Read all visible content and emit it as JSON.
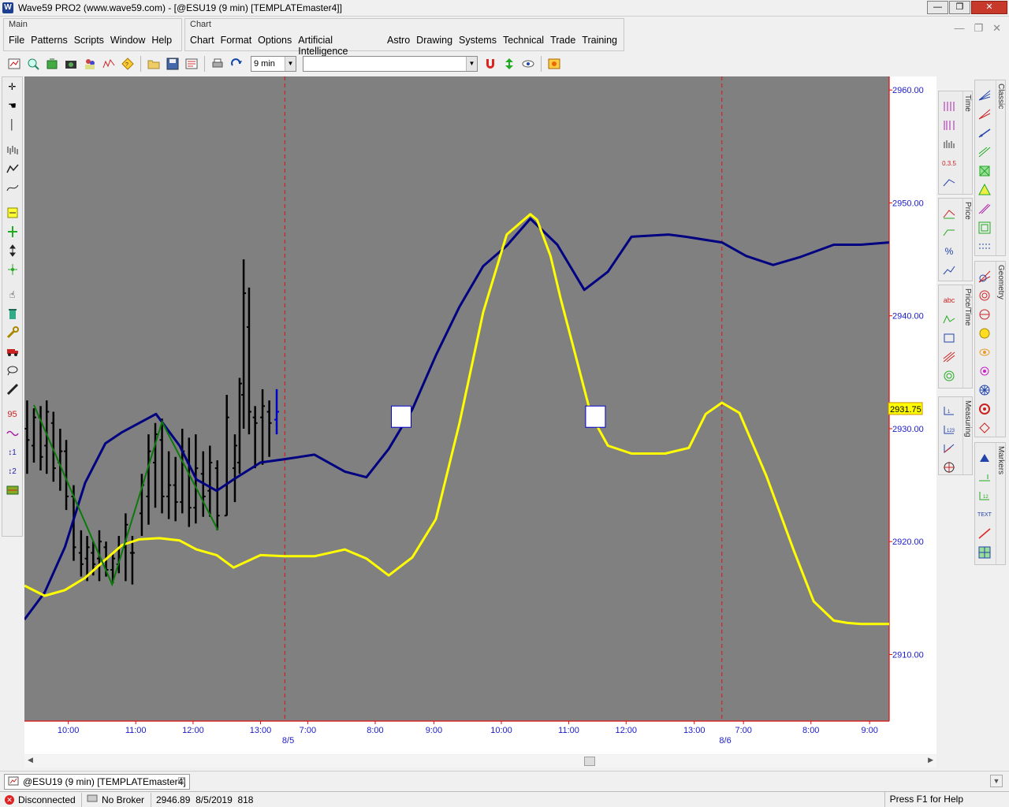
{
  "window": {
    "title": "Wave59 PRO2 (www.wave59.com) - [@ESU19 (9 min) [TEMPLATEmaster4]]",
    "buttons": [
      "—",
      "❐",
      "✕"
    ]
  },
  "main_panel": {
    "label": "Main",
    "menus": [
      "File",
      "Patterns",
      "Scripts",
      "Window",
      "Help"
    ]
  },
  "chart_panel": {
    "label": "Chart",
    "menus": [
      "Chart",
      "Format",
      "Options",
      "Artificial Intelligence",
      "Astro",
      "Drawing",
      "Systems",
      "Technical",
      "Trade",
      "Training"
    ]
  },
  "mdi_buttons": [
    "—",
    "❐",
    "✕"
  ],
  "toolbar": {
    "interval": "9 min",
    "symbol": ""
  },
  "palettes": {
    "classic": "Classic",
    "time": "Time",
    "price": "Price",
    "price_time": "Price/Time",
    "geometry": "Geometry",
    "measuring": "Measuring",
    "markers": "Markers"
  },
  "doc_tab": "@ESU19 (9 min) [TEMPLATEmaster4]",
  "status": {
    "connection": "Disconnected",
    "broker": "No Broker",
    "price": "2946.89",
    "date": "8/5/2019",
    "bar": "818",
    "help": "Press F1 for Help"
  },
  "chart_data": {
    "type": "line",
    "y_ticks": [
      "2960.00",
      "2950.00",
      "2940.00",
      "2930.00",
      "2920.00",
      "2910.00"
    ],
    "y_tick_values": [
      2960,
      2950,
      2940,
      2930,
      2920,
      2910
    ],
    "ylim": [
      2904.1,
      2961.2
    ],
    "price_marker": "2931.75",
    "price_marker_value": 2931.75,
    "x_ticks": [
      {
        "label": "10:00",
        "idx": 6.5
      },
      {
        "label": "11:00",
        "idx": 16.5
      },
      {
        "label": "12:00",
        "idx": 25.0
      },
      {
        "label": "13:00",
        "idx": 35.0
      },
      {
        "label": "7:00",
        "idx": 42.0
      },
      {
        "label": "8:00",
        "idx": 52.0
      },
      {
        "label": "9:00",
        "idx": 60.7
      },
      {
        "label": "10:00",
        "idx": 70.7
      },
      {
        "label": "11:00",
        "idx": 80.7
      },
      {
        "label": "12:00",
        "idx": 89.2
      },
      {
        "label": "13:00",
        "idx": 99.3
      },
      {
        "label": "7:00",
        "idx": 106.6
      },
      {
        "label": "8:00",
        "idx": 116.6
      },
      {
        "label": "9:00",
        "idx": 125.3
      }
    ],
    "date_labels": [
      {
        "label": "8/5",
        "idx": 39.1
      },
      {
        "label": "8/6",
        "idx": 103.9
      }
    ],
    "session_breaks": [
      38.6,
      103.4
    ],
    "x_range": [
      0,
      128.2
    ],
    "background": "#808080",
    "series": [
      {
        "color": "#000080",
        "x": [
          0,
          3,
          6,
          9,
          12,
          14.5,
          17,
          19.5,
          23,
          25.5,
          28.5,
          31,
          35,
          38.6,
          43,
          47.5,
          50.7,
          54,
          57.5,
          61,
          64.5,
          68,
          71.5,
          75,
          79,
          83,
          86.5,
          90,
          95.5,
          98,
          103.4,
          107,
          111,
          115,
          120,
          124,
          128.2
        ],
        "y": [
          2913.1,
          2915.5,
          2919.5,
          2925.2,
          2928.7,
          2929.7,
          2930.5,
          2931.3,
          2928.5,
          2925.5,
          2924.5,
          2925.5,
          2927.0,
          2927.3,
          2927.7,
          2926.2,
          2925.7,
          2928.2,
          2931.7,
          2936.5,
          2940.8,
          2944.4,
          2946.2,
          2948.6,
          2946.3,
          2942.3,
          2943.9,
          2947.0,
          2947.2,
          2947.0,
          2946.5,
          2945.3,
          2944.5,
          2945.2,
          2946.3,
          2946.3,
          2946.5
        ]
      },
      {
        "color": "#ffff00",
        "x": [
          0,
          3,
          6,
          9,
          12,
          14.5,
          17,
          20,
          23,
          25.5,
          28.5,
          31,
          35,
          38.6,
          43,
          47.5,
          50.7,
          54,
          57.5,
          61,
          64.5,
          68,
          71.5,
          75,
          76,
          78,
          79.5,
          82,
          84,
          86.5,
          90,
          95,
          98.5,
          101,
          103.4,
          106,
          110,
          114,
          117,
          120,
          122,
          124,
          128.2
        ],
        "y": [
          2916.1,
          2915.2,
          2915.7,
          2916.8,
          2918.4,
          2919.7,
          2920.2,
          2920.3,
          2920.1,
          2919.3,
          2918.8,
          2917.7,
          2918.8,
          2918.7,
          2918.7,
          2919.3,
          2918.5,
          2917.0,
          2918.6,
          2922.0,
          2930.5,
          2940.3,
          2947.2,
          2949.0,
          2948.5,
          2945.3,
          2941.5,
          2935.8,
          2931.2,
          2928.5,
          2927.8,
          2927.8,
          2928.3,
          2931.3,
          2932.3,
          2931.4,
          2925.8,
          2919.3,
          2914.7,
          2913.0,
          2912.8,
          2912.7,
          2912.7
        ]
      }
    ],
    "green_zigzag": {
      "x": [
        1.4,
        13.0,
        20.4,
        28.7
      ],
      "y": [
        2932.1,
        2916.2,
        2930.6,
        2921.0
      ]
    },
    "markers": [
      {
        "x": 55.8,
        "y": 2931.1
      },
      {
        "x": 84.6,
        "y": 2931.1
      }
    ],
    "bars": [
      {
        "x": 0.4,
        "h": 2932.5,
        "l": 2926.0,
        "o": 2930.0,
        "c": 2929.0
      },
      {
        "x": 1.4,
        "h": 2931.8,
        "l": 2927.0,
        "o": 2928.5,
        "c": 2931.0
      },
      {
        "x": 2.4,
        "h": 2932.0,
        "l": 2926.3,
        "o": 2931.0,
        "c": 2927.5
      },
      {
        "x": 3.3,
        "h": 2932.5,
        "l": 2926.0,
        "o": 2928.5,
        "c": 2931.5
      },
      {
        "x": 4.3,
        "h": 2931.5,
        "l": 2925.3,
        "o": 2930.5,
        "c": 2926.5
      },
      {
        "x": 5.3,
        "h": 2930.0,
        "l": 2924.5,
        "o": 2927.0,
        "c": 2928.0
      },
      {
        "x": 6.2,
        "h": 2929.0,
        "l": 2922.8,
        "o": 2928.0,
        "c": 2924.0
      },
      {
        "x": 7.3,
        "h": 2925.0,
        "l": 2918.3,
        "o": 2924.0,
        "c": 2919.5
      },
      {
        "x": 8.4,
        "h": 2921.0,
        "l": 2916.9,
        "o": 2919.0,
        "c": 2918.0
      },
      {
        "x": 9.3,
        "h": 2920.5,
        "l": 2916.5,
        "o": 2918.5,
        "c": 2919.5
      },
      {
        "x": 10.2,
        "h": 2920.0,
        "l": 2917.0,
        "o": 2919.0,
        "c": 2918.0
      },
      {
        "x": 11.1,
        "h": 2921.0,
        "l": 2916.5,
        "o": 2918.5,
        "c": 2920.0
      },
      {
        "x": 12.1,
        "h": 2920.0,
        "l": 2916.9,
        "o": 2919.5,
        "c": 2917.5
      },
      {
        "x": 13.1,
        "h": 2919.0,
        "l": 2916.3,
        "o": 2917.5,
        "c": 2918.5
      },
      {
        "x": 14.0,
        "h": 2920.5,
        "l": 2917.2,
        "o": 2918.0,
        "c": 2919.5
      },
      {
        "x": 15.0,
        "h": 2922.5,
        "l": 2916.5,
        "o": 2919.5,
        "c": 2921.5
      },
      {
        "x": 16.0,
        "h": 2920.5,
        "l": 2916.2,
        "o": 2919.0,
        "c": 2919.0
      },
      {
        "x": 17.4,
        "h": 2926.0,
        "l": 2920.5,
        "o": 2922.5,
        "c": 2925.0
      },
      {
        "x": 18.4,
        "h": 2929.5,
        "l": 2921.5,
        "o": 2924.0,
        "c": 2928.0
      },
      {
        "x": 19.4,
        "h": 2930.5,
        "l": 2923.0,
        "o": 2927.0,
        "c": 2929.5
      },
      {
        "x": 20.4,
        "h": 2930.9,
        "l": 2922.5,
        "o": 2929.0,
        "c": 2924.0
      },
      {
        "x": 21.4,
        "h": 2928.0,
        "l": 2922.0,
        "o": 2924.0,
        "c": 2925.0
      },
      {
        "x": 22.4,
        "h": 2927.5,
        "l": 2921.8,
        "o": 2925.0,
        "c": 2923.5
      },
      {
        "x": 23.4,
        "h": 2930.0,
        "l": 2922.5,
        "o": 2923.5,
        "c": 2928.0
      },
      {
        "x": 24.4,
        "h": 2929.2,
        "l": 2921.3,
        "o": 2927.0,
        "c": 2923.0
      },
      {
        "x": 25.4,
        "h": 2929.5,
        "l": 2921.6,
        "o": 2923.0,
        "c": 2926.5
      },
      {
        "x": 26.5,
        "h": 2928.0,
        "l": 2922.2,
        "o": 2926.0,
        "c": 2924.0
      },
      {
        "x": 27.5,
        "h": 2928.5,
        "l": 2922.2,
        "o": 2924.5,
        "c": 2927.0
      },
      {
        "x": 28.6,
        "h": 2927.2,
        "l": 2921.0,
        "o": 2926.5,
        "c": 2922.3
      },
      {
        "x": 30.0,
        "h": 2933.0,
        "l": 2922.3,
        "o": 2922.3,
        "c": 2931.0
      },
      {
        "x": 31.2,
        "h": 2929.5,
        "l": 2923.5,
        "o": 2926.5,
        "c": 2928.5
      },
      {
        "x": 31.9,
        "h": 2934.5,
        "l": 2926.0,
        "o": 2927.0,
        "c": 2934.0
      },
      {
        "x": 32.5,
        "h": 2945.0,
        "l": 2930.0,
        "o": 2933.0,
        "c": 2942.0
      },
      {
        "x": 33.3,
        "h": 2942.5,
        "l": 2929.5,
        "o": 2939.0,
        "c": 2931.5
      },
      {
        "x": 34.2,
        "h": 2932.0,
        "l": 2926.5,
        "o": 2931.0,
        "c": 2930.5
      },
      {
        "x": 35.3,
        "h": 2933.5,
        "l": 2926.8,
        "o": 2931.0,
        "c": 2932.0
      },
      {
        "x": 36.3,
        "h": 2932.5,
        "l": 2927.5,
        "o": 2931.5,
        "c": 2930.5
      },
      {
        "x": 37.4,
        "h": 2933.5,
        "l": 2929.5,
        "o": 2930.8,
        "c": 2931.5,
        "color": "#0000cc"
      }
    ]
  }
}
